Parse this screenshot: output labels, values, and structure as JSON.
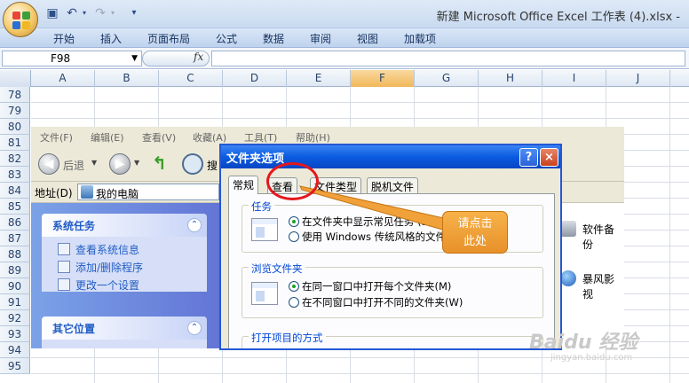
{
  "window": {
    "title": "新建 Microsoft Office Excel 工作表 (4).xlsx -"
  },
  "qat": {
    "save_icon": "save-icon",
    "undo_icon": "undo-icon",
    "redo_icon": "redo-icon",
    "customize_icon": "customize-icon"
  },
  "ribbon": {
    "tabs": [
      "开始",
      "插入",
      "页面布局",
      "公式",
      "数据",
      "审阅",
      "视图",
      "加载项"
    ]
  },
  "formula_bar": {
    "name_box": "F98",
    "fx": "fx",
    "value": ""
  },
  "columns": [
    "A",
    "B",
    "C",
    "D",
    "E",
    "F",
    "G",
    "H",
    "I",
    "J"
  ],
  "selected_column": "F",
  "rows": [
    "78",
    "79",
    "80",
    "81",
    "82",
    "83",
    "84",
    "85",
    "86",
    "87",
    "88",
    "89",
    "90",
    "91",
    "92",
    "93",
    "94",
    "95"
  ],
  "explorer": {
    "menus": [
      "文件(F)",
      "编辑(E)",
      "查看(V)",
      "收藏(A)",
      "工具(T)",
      "帮助(H)"
    ],
    "back_label": "后退",
    "search_label": "搜",
    "address_label": "地址(D)",
    "address_value": "我的电脑",
    "system_tasks": {
      "title": "系统任务",
      "items": [
        "查看系统信息",
        "添加/删除程序",
        "更改一个设置"
      ]
    },
    "other_places": {
      "title": "其它位置"
    },
    "desktop_items": [
      "软件备份",
      "暴风影视"
    ]
  },
  "dialog": {
    "title": "文件夹选项",
    "help_btn": "?",
    "close_btn": "×",
    "tabs": [
      "常规",
      "查看",
      "文件类型",
      "脱机文件"
    ],
    "active_tab": "常规",
    "group_tasks": {
      "label": "任务",
      "options": [
        "在文件夹中显示常见任务 (S)",
        "使用 Windows 传统风格的文件"
      ],
      "selected": 0
    },
    "group_browse": {
      "label": "浏览文件夹",
      "options": [
        "在同一窗口中打开每个文件夹(M)",
        "在不同窗口中打开不同的文件夹(W)"
      ],
      "selected": 0
    },
    "group_open": {
      "label": "打开项目的方式"
    }
  },
  "annotation": {
    "callout": "请点击此处",
    "line1": "请点击",
    "line2": "此处"
  },
  "watermark": {
    "text": "Baidu 经验",
    "sub": "jingyan.baidu.com"
  }
}
